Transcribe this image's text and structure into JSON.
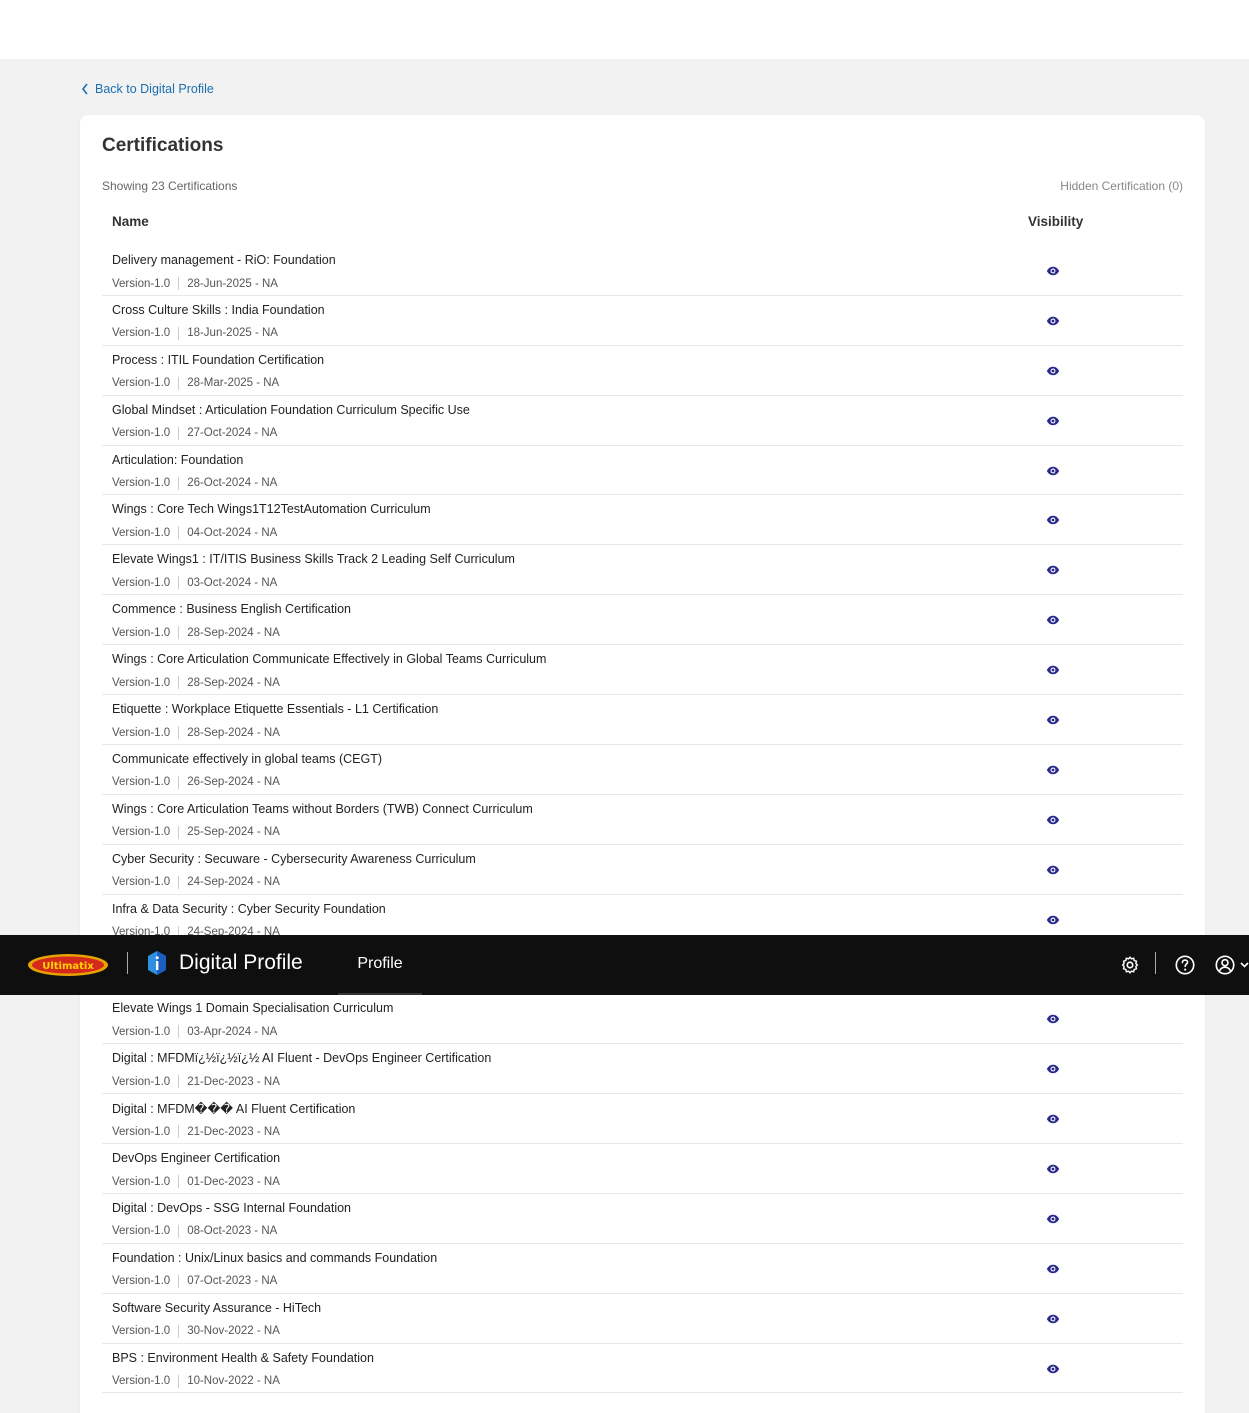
{
  "back_link": "Back to Digital Profile",
  "card": {
    "title": "Certifications",
    "showing": "Showing 23 Certifications",
    "hidden": "Hidden Certification (0)",
    "col_name": "Name",
    "col_visibility": "Visibility"
  },
  "rows": [
    {
      "title": "Delivery management - RiO: Foundation",
      "version": "Version-1.0",
      "date": "28-Jun-2025 - NA"
    },
    {
      "title": "Cross Culture Skills : India Foundation",
      "version": "Version-1.0",
      "date": "18-Jun-2025 - NA"
    },
    {
      "title": "Process : ITIL Foundation Certification",
      "version": "Version-1.0",
      "date": "28-Mar-2025 - NA"
    },
    {
      "title": "Global Mindset : Articulation Foundation Curriculum Specific Use",
      "version": "Version-1.0",
      "date": "27-Oct-2024 - NA"
    },
    {
      "title": "Articulation: Foundation",
      "version": "Version-1.0",
      "date": "26-Oct-2024 - NA"
    },
    {
      "title": "Wings : Core Tech Wings1T12TestAutomation Curriculum",
      "version": "Version-1.0",
      "date": "04-Oct-2024 - NA"
    },
    {
      "title": "Elevate Wings1 : IT/ITIS Business Skills Track 2 Leading Self Curriculum",
      "version": "Version-1.0",
      "date": "03-Oct-2024 - NA"
    },
    {
      "title": "Commence : Business English Certification",
      "version": "Version-1.0",
      "date": "28-Sep-2024 - NA"
    },
    {
      "title": "Wings : Core Articulation Communicate Effectively in Global Teams Curriculum",
      "version": "Version-1.0",
      "date": "28-Sep-2024 - NA"
    },
    {
      "title": "Etiquette : Workplace Etiquette Essentials - L1 Certification",
      "version": "Version-1.0",
      "date": "28-Sep-2024 - NA"
    },
    {
      "title": "Communicate effectively in global teams (CEGT)",
      "version": "Version-1.0",
      "date": "26-Sep-2024 - NA"
    },
    {
      "title": "Wings : Core Articulation Teams without Borders (TWB) Connect Curriculum",
      "version": "Version-1.0",
      "date": "25-Sep-2024 - NA"
    },
    {
      "title": "Cyber Security : Secuware - Cybersecurity Awareness Curriculum",
      "version": "Version-1.0",
      "date": "24-Sep-2024 - NA"
    },
    {
      "title": "Infra & Data Security : Cyber Security Foundation",
      "version": "Version-1.0",
      "date": "24-Sep-2024 - NA"
    },
    {
      "title": "",
      "version": "",
      "date": ""
    },
    {
      "title": "Elevate Wings 1 Domain Specialisation Curriculum",
      "version": "Version-1.0",
      "date": "03-Apr-2024 - NA"
    },
    {
      "title": "Digital : MFDMï¿½ï¿½ï¿½ AI Fluent - DevOps Engineer Certification",
      "version": "Version-1.0",
      "date": "21-Dec-2023 - NA"
    },
    {
      "title": "Digital : MFDM��� AI Fluent Certification",
      "version": "Version-1.0",
      "date": "21-Dec-2023 - NA"
    },
    {
      "title": "DevOps Engineer Certification",
      "version": "Version-1.0",
      "date": "01-Dec-2023 - NA"
    },
    {
      "title": "Digital : DevOps - SSG Internal Foundation",
      "version": "Version-1.0",
      "date": "08-Oct-2023 - NA"
    },
    {
      "title": "Foundation : Unix/Linux basics and commands Foundation",
      "version": "Version-1.0",
      "date": "07-Oct-2023 - NA"
    },
    {
      "title": "Software Security Assurance - HiTech",
      "version": "Version-1.0",
      "date": "30-Nov-2022 - NA"
    },
    {
      "title": "BPS : Environment Health & Safety Foundation",
      "version": "Version-1.0",
      "date": "10-Nov-2022 - NA"
    }
  ],
  "navbar": {
    "logo_text": "Ultimatix",
    "app_title": "Digital Profile",
    "tab_profile": "Profile"
  },
  "colors": {
    "accent_link": "#1b6fb0",
    "eye_icon": "#2a2a8c",
    "navbar_bg": "#0f0f0f"
  }
}
